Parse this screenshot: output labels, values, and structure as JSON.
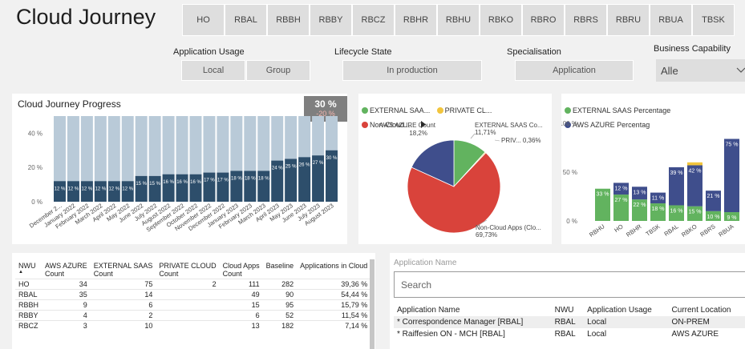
{
  "header": {
    "title": "Cloud Journey"
  },
  "nwu_buttons": [
    "HO",
    "RBAL",
    "RBBH",
    "RBBY",
    "RBCZ",
    "RBHR",
    "RBHU",
    "RBKO",
    "RBRO",
    "RBRS",
    "RBRU",
    "RBUA",
    "TBSK"
  ],
  "slicers": {
    "application_usage": {
      "title": "Application Usage",
      "options": [
        "Local",
        "Group"
      ]
    },
    "lifecycle_state": {
      "title": "Lifecycle State",
      "options": [
        "In production"
      ]
    },
    "specialisation": {
      "title": "Specialisation",
      "options": [
        "Application"
      ]
    },
    "business_capability": {
      "title": "Business Capability",
      "selected": "Alle",
      "chevron": "chevron-down-icon"
    }
  },
  "progress_chart": {
    "title": "Cloud Journey Progress",
    "kpi_value": "30 %",
    "kpi_delta": "-20 %"
  },
  "pie_legend": {
    "items": [
      "EXTERNAL SAA...",
      "PRIVATE CL...",
      "Non-Cloud ..."
    ],
    "more_icon": "play-icon"
  },
  "pie_labels": {
    "aws": "AWS AZURE Count",
    "aws_pct": "18,2%",
    "ext": "EXTERNAL SAAS Co...",
    "ext_pct": "11,71%",
    "priv": "PRIV... 0,36%",
    "noncloud": "Non-Cloud Apps (Clo...",
    "noncloud_pct": "69,73%"
  },
  "stacked_legend": {
    "items": [
      "EXTERNAL SAAS Percentage",
      "AWS AZURE Percentag"
    ]
  },
  "nwu_table": {
    "headers": [
      "NWU",
      "AWS AZURE Count",
      "EXTERNAL SAAS Count",
      "PRIVATE CLOUD Count",
      "Cloud Apps Count",
      "Baseline",
      "Applications in Cloud"
    ],
    "header_lines": [
      [
        "NWU"
      ],
      [
        "AWS AZURE",
        "Count"
      ],
      [
        "EXTERNAL SAAS",
        "Count"
      ],
      [
        "PRIVATE CLOUD",
        "Count"
      ],
      [
        "Cloud Apps",
        "Count"
      ],
      [
        "Baseline"
      ],
      [
        "Applications in Cloud"
      ]
    ],
    "rows": [
      [
        "HO",
        "34",
        "75",
        "2",
        "111",
        "282",
        "39,36 %"
      ],
      [
        "RBAL",
        "35",
        "14",
        "",
        "49",
        "90",
        "54,44 %"
      ],
      [
        "RBBH",
        "9",
        "6",
        "",
        "15",
        "95",
        "15,79 %"
      ],
      [
        "RBBY",
        "4",
        "2",
        "",
        "6",
        "52",
        "11,54 %"
      ],
      [
        "RBCZ",
        "3",
        "10",
        "",
        "13",
        "182",
        "7,14 %"
      ]
    ]
  },
  "app_search": {
    "label": "Application Name",
    "placeholder": "Search"
  },
  "app_table": {
    "headers": [
      "Application Name",
      "NWU",
      "Application Usage",
      "Current Location"
    ],
    "rows": [
      [
        "* Correspondence Manager [RBAL]",
        "RBAL",
        "Local",
        "ON-PREM"
      ],
      [
        "* Raiffesien ON - MCH [RBAL]",
        "RBAL",
        "Local",
        "AWS AZURE"
      ]
    ]
  },
  "colors": {
    "dark_bar": "#2d4e6b",
    "light_bar": "#b9cad8",
    "green": "#62b35f",
    "yellow": "#f2c53d",
    "red": "#d9433b",
    "navy": "#3f4e8c",
    "kpi_bg": "#7f7f7f"
  },
  "chart_data": [
    {
      "type": "bar",
      "name": "Cloud Journey Progress",
      "categories": [
        "December 2...",
        "January 2022",
        "February 2022",
        "March 2022",
        "April 2022",
        "May 2022",
        "June 2022",
        "July 2022",
        "August 2022",
        "September 2022",
        "October 2022",
        "November 2022",
        "December 2022",
        "January 2023",
        "February 2023",
        "March 2023",
        "April 2023",
        "May 2023",
        "June 2023",
        "July 2023",
        "August 2023"
      ],
      "series": [
        {
          "values": [
            12,
            12,
            12,
            12,
            12,
            12,
            15,
            15,
            16,
            16,
            16,
            17,
            17,
            18,
            18,
            18,
            24,
            25,
            26,
            27,
            30
          ],
          "labels": [
            "12 %",
            "12 %",
            "12 %",
            "12 %",
            "12 %",
            "12 %",
            "15 %",
            "15 %",
            "16 %",
            "16 %",
            "16 %",
            "17 %",
            "17 %",
            "18 %",
            "18 %",
            "18 %",
            "24 %",
            "25 %",
            "26 %",
            "27 %",
            "30 %"
          ]
        }
      ],
      "y_ticks": [
        "0 %",
        "20 %",
        "40 %"
      ],
      "ylim": [
        0,
        50
      ]
    },
    {
      "type": "pie",
      "name": "Cloud share",
      "series": [
        {
          "name": "EXTERNAL SAAS Count",
          "value": 11.71
        },
        {
          "name": "PRIVATE CLOUD",
          "value": 0.36
        },
        {
          "name": "Non-Cloud Apps",
          "value": 69.73
        },
        {
          "name": "AWS AZURE Count",
          "value": 18.2
        }
      ]
    },
    {
      "type": "bar",
      "name": "Percentage by NWU",
      "categories": [
        "RBHU",
        "HO",
        "RBHR",
        "TBSK",
        "RBAL",
        "RBKO",
        "RBRS",
        "RBUA"
      ],
      "series": [
        {
          "name": "EXTERNAL SAAS Percentage",
          "values": [
            33,
            27,
            22,
            18,
            16,
            15,
            10,
            9
          ],
          "labels": [
            "33 %",
            "27 %",
            "22 %",
            "18 %",
            "16 %",
            "15 %",
            "10 %",
            "9 %"
          ]
        },
        {
          "name": "AWS AZURE Percentage",
          "values": [
            0,
            12,
            13,
            11,
            39,
            42,
            21,
            75
          ],
          "labels": [
            "",
            "12 %",
            "13 %",
            "11 %",
            "39 %",
            "42 %",
            "21 %",
            "75 %"
          ]
        },
        {
          "name": "PRIVATE CLOUD",
          "values": [
            0,
            0,
            0,
            0,
            0,
            3,
            0,
            0
          ]
        }
      ],
      "y_ticks": [
        "0 %",
        "50 %",
        "100 %"
      ],
      "ylim": [
        0,
        100
      ]
    }
  ]
}
